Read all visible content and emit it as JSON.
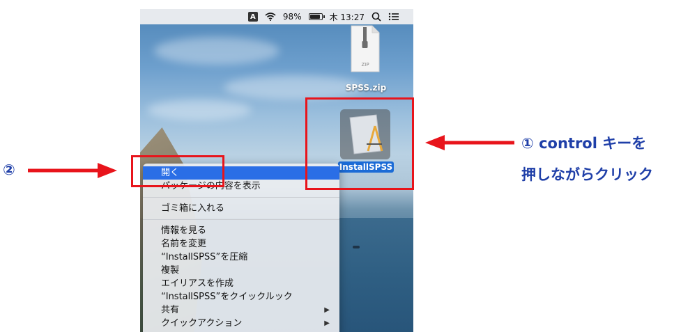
{
  "menubar": {
    "input_indicator": "A",
    "battery_percent": "98%",
    "battery_level": 0.98,
    "clock": "木 13:27",
    "icons": [
      "wifi-icon",
      "battery-icon",
      "search-icon",
      "control-center-icon"
    ]
  },
  "desktop": {
    "zip_file": {
      "icon_text": "ZIP",
      "label": "SPSS.zip"
    },
    "app_file": {
      "label": "InstallSPSS"
    }
  },
  "context_menu": {
    "items": [
      {
        "label": "開く",
        "highlighted": true
      },
      {
        "label": "パッケージの内容を表示"
      },
      {
        "label": "ゴミ箱に入れる"
      },
      {
        "label": "情報を見る"
      },
      {
        "label": "名前を変更"
      },
      {
        "label": "“InstallSPSS”を圧縮"
      },
      {
        "label": "複製"
      },
      {
        "label": "エイリアスを作成"
      },
      {
        "label": "“InstallSPSS”をクイックルック"
      },
      {
        "label": "共有",
        "submenu": true
      },
      {
        "label": "クイックアクション",
        "submenu": true
      }
    ]
  },
  "annotations": {
    "step1_line1": "① control キーを",
    "step1_line2": "押しながらクリック",
    "step2": "②",
    "colors": {
      "highlight_box": "#e8141b",
      "arrow": "#e8141b",
      "text": "#1f3fa8"
    }
  }
}
